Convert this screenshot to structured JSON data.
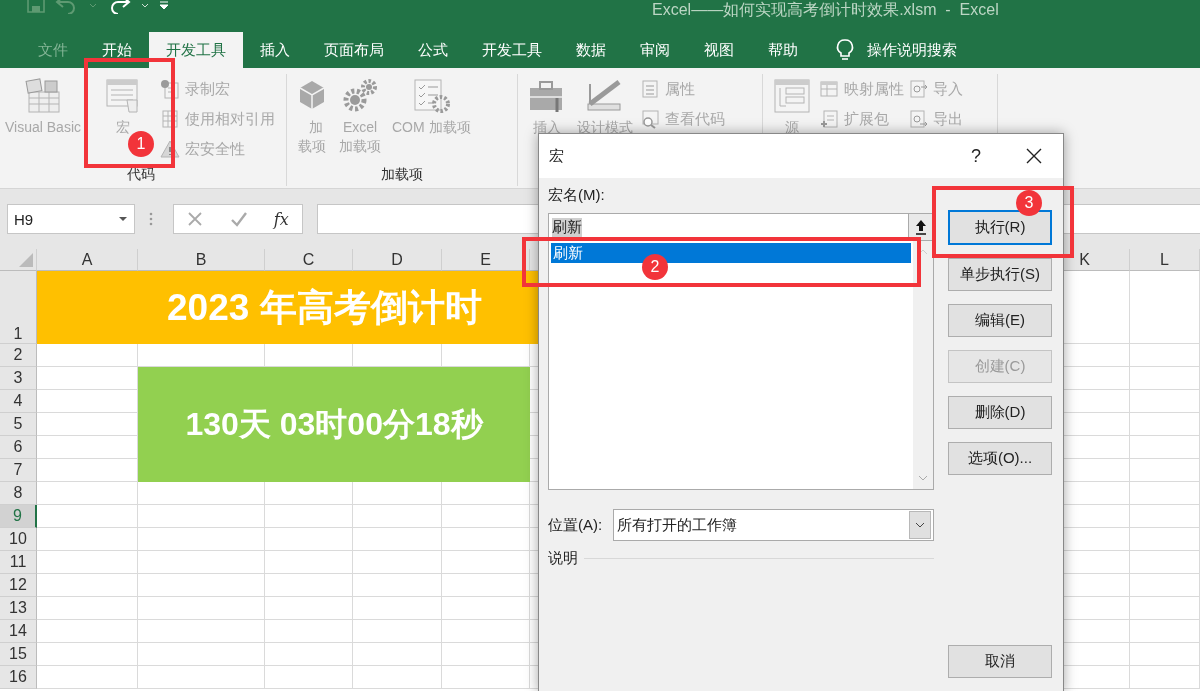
{
  "title_bar": {
    "title": "Excel——如何实现高考倒计时效果.xlsm  -  Excel"
  },
  "ribbon_tabs": [
    {
      "label": "文件",
      "selected": false,
      "disabled": true
    },
    {
      "label": "开始",
      "selected": false,
      "disabled": false
    },
    {
      "label": "开发工具",
      "selected": true,
      "disabled": false
    },
    {
      "label": "插入",
      "selected": false,
      "disabled": false
    },
    {
      "label": "页面布局",
      "selected": false,
      "disabled": false
    },
    {
      "label": "公式",
      "selected": false,
      "disabled": false
    },
    {
      "label": "开发工具",
      "selected": false,
      "disabled": false
    },
    {
      "label": "数据",
      "selected": false,
      "disabled": false
    },
    {
      "label": "审阅",
      "selected": false,
      "disabled": false
    },
    {
      "label": "视图",
      "selected": false,
      "disabled": false
    },
    {
      "label": "帮助",
      "selected": false,
      "disabled": false
    }
  ],
  "tell_me": {
    "label": "操作说明搜索"
  },
  "ribbon": {
    "disabled": true,
    "groups": [
      {
        "label": "代码",
        "large": [
          {
            "label": "Visual Basic",
            "kind": "vb"
          },
          {
            "label": "宏",
            "kind": "macro"
          }
        ],
        "small": [
          [
            {
              "label": "录制宏",
              "kind": "record"
            },
            {
              "label": "使用相对引用",
              "kind": "relative"
            },
            {
              "label": "宏安全性",
              "kind": "warning"
            }
          ]
        ]
      },
      {
        "label": "加载项",
        "large": [
          {
            "label": "加载项",
            "kind": "cube"
          },
          {
            "label": "Excel 加载项",
            "kind": "gears"
          },
          {
            "label": "COM 加载项",
            "kind": "checklist"
          }
        ]
      },
      {
        "large": [
          {
            "label": "插入",
            "kind": "toolbox"
          },
          {
            "label": "设计模式",
            "kind": "ruler"
          }
        ],
        "small": [
          [
            {
              "label": "属性",
              "kind": "props"
            },
            {
              "label": "查看代码",
              "kind": "code"
            }
          ]
        ]
      },
      {
        "large": [
          {
            "label": "源",
            "kind": "source"
          }
        ],
        "small": [
          [
            {
              "label": "映射属性",
              "kind": "map"
            },
            {
              "label": "扩展包",
              "kind": "pack"
            }
          ],
          [
            {
              "label": "导入",
              "kind": "import"
            },
            {
              "label": "导出",
              "kind": "export"
            }
          ]
        ]
      }
    ]
  },
  "formula_bar": {
    "name_box": "H9",
    "function_label": "fx"
  },
  "sheet": {
    "columns_left": [
      "A",
      "B",
      "C",
      "D",
      "E"
    ],
    "columns_right": [
      "K",
      "L"
    ],
    "rows": [
      {
        "label": "1",
        "selected": false
      },
      {
        "label": "2",
        "selected": false
      },
      {
        "label": "3",
        "selected": false
      },
      {
        "label": "4",
        "selected": false
      },
      {
        "label": "5",
        "selected": false
      },
      {
        "label": "6",
        "selected": false
      },
      {
        "label": "7",
        "selected": false
      },
      {
        "label": "8",
        "selected": false
      },
      {
        "label": "9",
        "selected": true
      },
      {
        "label": "10",
        "selected": false
      },
      {
        "label": "11",
        "selected": false
      },
      {
        "label": "12",
        "selected": false
      },
      {
        "label": "13",
        "selected": false
      },
      {
        "label": "14",
        "selected": false
      },
      {
        "label": "15",
        "selected": false
      },
      {
        "label": "16",
        "selected": false
      }
    ],
    "title_cell": "2023 年高考倒计时",
    "countdown_cell": "130天 03时00分18秒"
  },
  "dialog": {
    "title": "宏",
    "help": "?",
    "macro_name_label": "宏名(M):",
    "macro_name_value": "刷新",
    "macros": [
      {
        "name": "刷新",
        "selected": true
      }
    ],
    "buttons": [
      {
        "label": "执行(R)",
        "default": true,
        "disabled": false
      },
      {
        "label": "单步执行(S)",
        "default": false,
        "disabled": false
      },
      {
        "label": "编辑(E)",
        "default": false,
        "disabled": false
      },
      {
        "label": "创建(C)",
        "default": false,
        "disabled": true
      },
      {
        "label": "删除(D)",
        "default": false,
        "disabled": false
      },
      {
        "label": "选项(O)...",
        "default": false,
        "disabled": false
      }
    ],
    "location_label": "位置(A):",
    "location_value": "所有打开的工作簿",
    "description_label": "说明",
    "cancel": "取消"
  },
  "annotations": [
    {
      "number": "1"
    },
    {
      "number": "2"
    },
    {
      "number": "3"
    }
  ]
}
